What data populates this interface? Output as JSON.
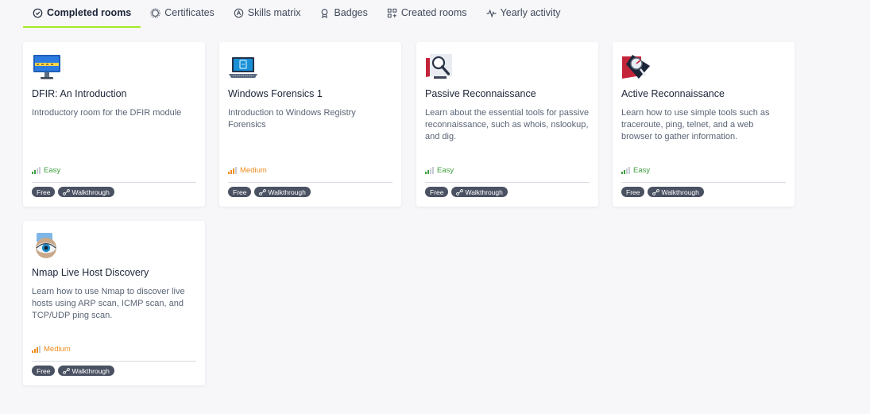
{
  "tabs": [
    {
      "label": "Completed rooms",
      "icon": "check-circle-icon"
    },
    {
      "label": "Certificates",
      "icon": "certificate-icon"
    },
    {
      "label": "Skills matrix",
      "icon": "skills-icon"
    },
    {
      "label": "Badges",
      "icon": "badge-icon"
    },
    {
      "label": "Created rooms",
      "icon": "grid-plus-icon"
    },
    {
      "label": "Yearly activity",
      "icon": "activity-icon"
    }
  ],
  "active_tab": "Completed rooms",
  "colors": {
    "accent": "#a3ea2a",
    "easy": "#3fa03f",
    "medium": "#ef8c1b",
    "tag_bg": "#4a5162"
  },
  "rooms": [
    {
      "title": "DFIR: An Introduction",
      "description": "Introductory room for the DFIR module",
      "difficulty": "Easy",
      "tags": [
        "Free",
        "Walkthrough"
      ],
      "icon": "monitor-icon"
    },
    {
      "title": "Windows Forensics 1",
      "description": "Introduction to Windows Registry Forensics",
      "difficulty": "Medium",
      "tags": [
        "Free",
        "Walkthrough"
      ],
      "icon": "laptop-icon"
    },
    {
      "title": "Passive Reconnaissance",
      "description": "Learn about the essential tools for passive reconnaissance, such as whois, nslookup, and dig.",
      "difficulty": "Easy",
      "tags": [
        "Free",
        "Walkthrough"
      ],
      "icon": "magnifier-icon"
    },
    {
      "title": "Active Reconnaissance",
      "description": "Learn how to use simple tools such as traceroute, ping, telnet, and a web browser to gather information.",
      "difficulty": "Easy",
      "tags": [
        "Free",
        "Walkthrough"
      ],
      "icon": "radar-icon"
    },
    {
      "title": "Nmap Live Host Discovery",
      "description": "Learn how to use Nmap to discover live hosts using ARP scan, ICMP scan, and TCP/UDP ping scan.",
      "difficulty": "Medium",
      "tags": [
        "Free",
        "Walkthrough"
      ],
      "icon": "eye-icon"
    }
  ]
}
